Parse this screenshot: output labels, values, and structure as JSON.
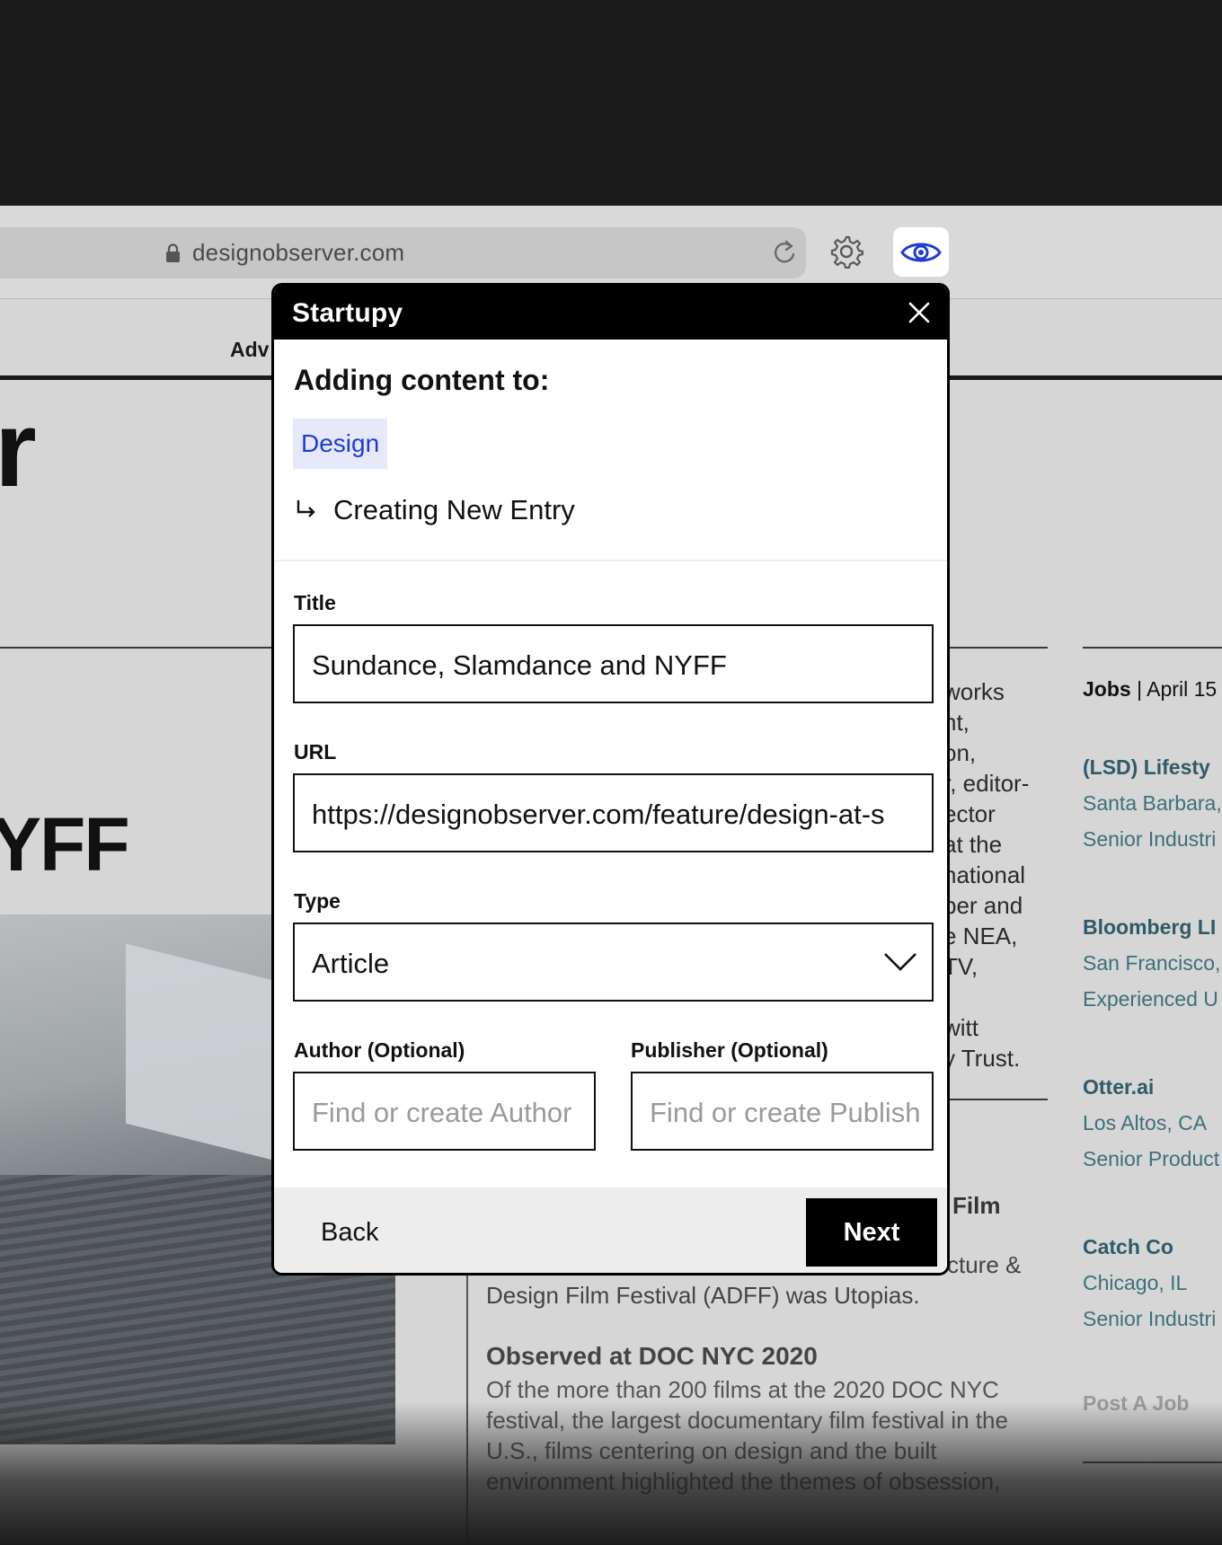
{
  "browser": {
    "address": "designobserver.com"
  },
  "site": {
    "nav_fragment": "Adv",
    "logo_fragment": "r",
    "headline_fragment": "YFF",
    "column_text": [
      "works",
      "nt,",
      "on,",
      "r, editor-",
      "ector",
      " at the",
      "national",
      "ber and",
      "e NEA,",
      "TV,",
      "",
      "witt",
      "y Trust."
    ],
    "film_fragment": "Film",
    "culture_fragment": "cture &",
    "article_line": "Design Film Festival (ADFF) was Utopias.",
    "observed_title": "Observed at DOC NYC 2020",
    "observed_body": "Of the more than 200 films at the 2020 DOC NYC festival, the largest documentary film festival in the U.S., films centering on design and the built environment highlighted the themes of obsession,",
    "jobs_label": "Jobs",
    "jobs_date": " | April 15",
    "jobs": [
      {
        "company": "(LSD) Lifesty",
        "location": "Santa Barbara,",
        "role": "Senior Industri"
      },
      {
        "company": "Bloomberg LI",
        "location": "San Francisco,",
        "role": "Experienced U"
      },
      {
        "company": "Otter.ai",
        "location": "Los Altos, CA",
        "role": "Senior Product"
      },
      {
        "company": "Catch Co",
        "location": "Chicago, IL",
        "role": "Senior Industri"
      }
    ],
    "post_job": "Post A Job"
  },
  "modal": {
    "app_title": "Startupy",
    "heading": "Adding content to:",
    "collection": "Design",
    "entry_label": "Creating New Entry",
    "title_label": "Title",
    "title_value": "Sundance, Slamdance and NYFF",
    "url_label": "URL",
    "url_value": "https://designobserver.com/feature/design-at-s",
    "type_label": "Type",
    "type_value": "Article",
    "author_label": "Author (Optional)",
    "author_placeholder": "Find or create Author",
    "publisher_label": "Publisher (Optional)",
    "publisher_placeholder": "Find or create Publish",
    "back_label": "Back",
    "next_label": "Next"
  },
  "colors": {
    "chip_bg": "#e6e9f9",
    "chip_text": "#1f3bd6",
    "extension_accent": "#1f3bd6",
    "job_company": "#2f5a66"
  },
  "icons": [
    "lock-icon",
    "reload-icon",
    "gear-icon",
    "eye-icon",
    "close-icon",
    "return-arrow-icon",
    "chevron-down-icon"
  ]
}
